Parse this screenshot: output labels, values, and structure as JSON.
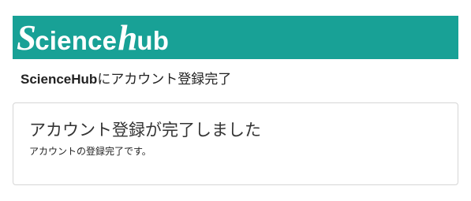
{
  "header": {
    "logo_parts": {
      "s": "S",
      "cience": "cience",
      "h": "h",
      "ub": "ub"
    }
  },
  "page_title": {
    "brand": "ScienceHub",
    "suffix": "にアカウント登録完了"
  },
  "card": {
    "title": "アカウント登録が完了しました",
    "text": "アカウントの登録完了です。"
  },
  "colors": {
    "header_bg": "#18a196",
    "logo_text": "#ffffff",
    "card_border": "#d6d6d6"
  }
}
